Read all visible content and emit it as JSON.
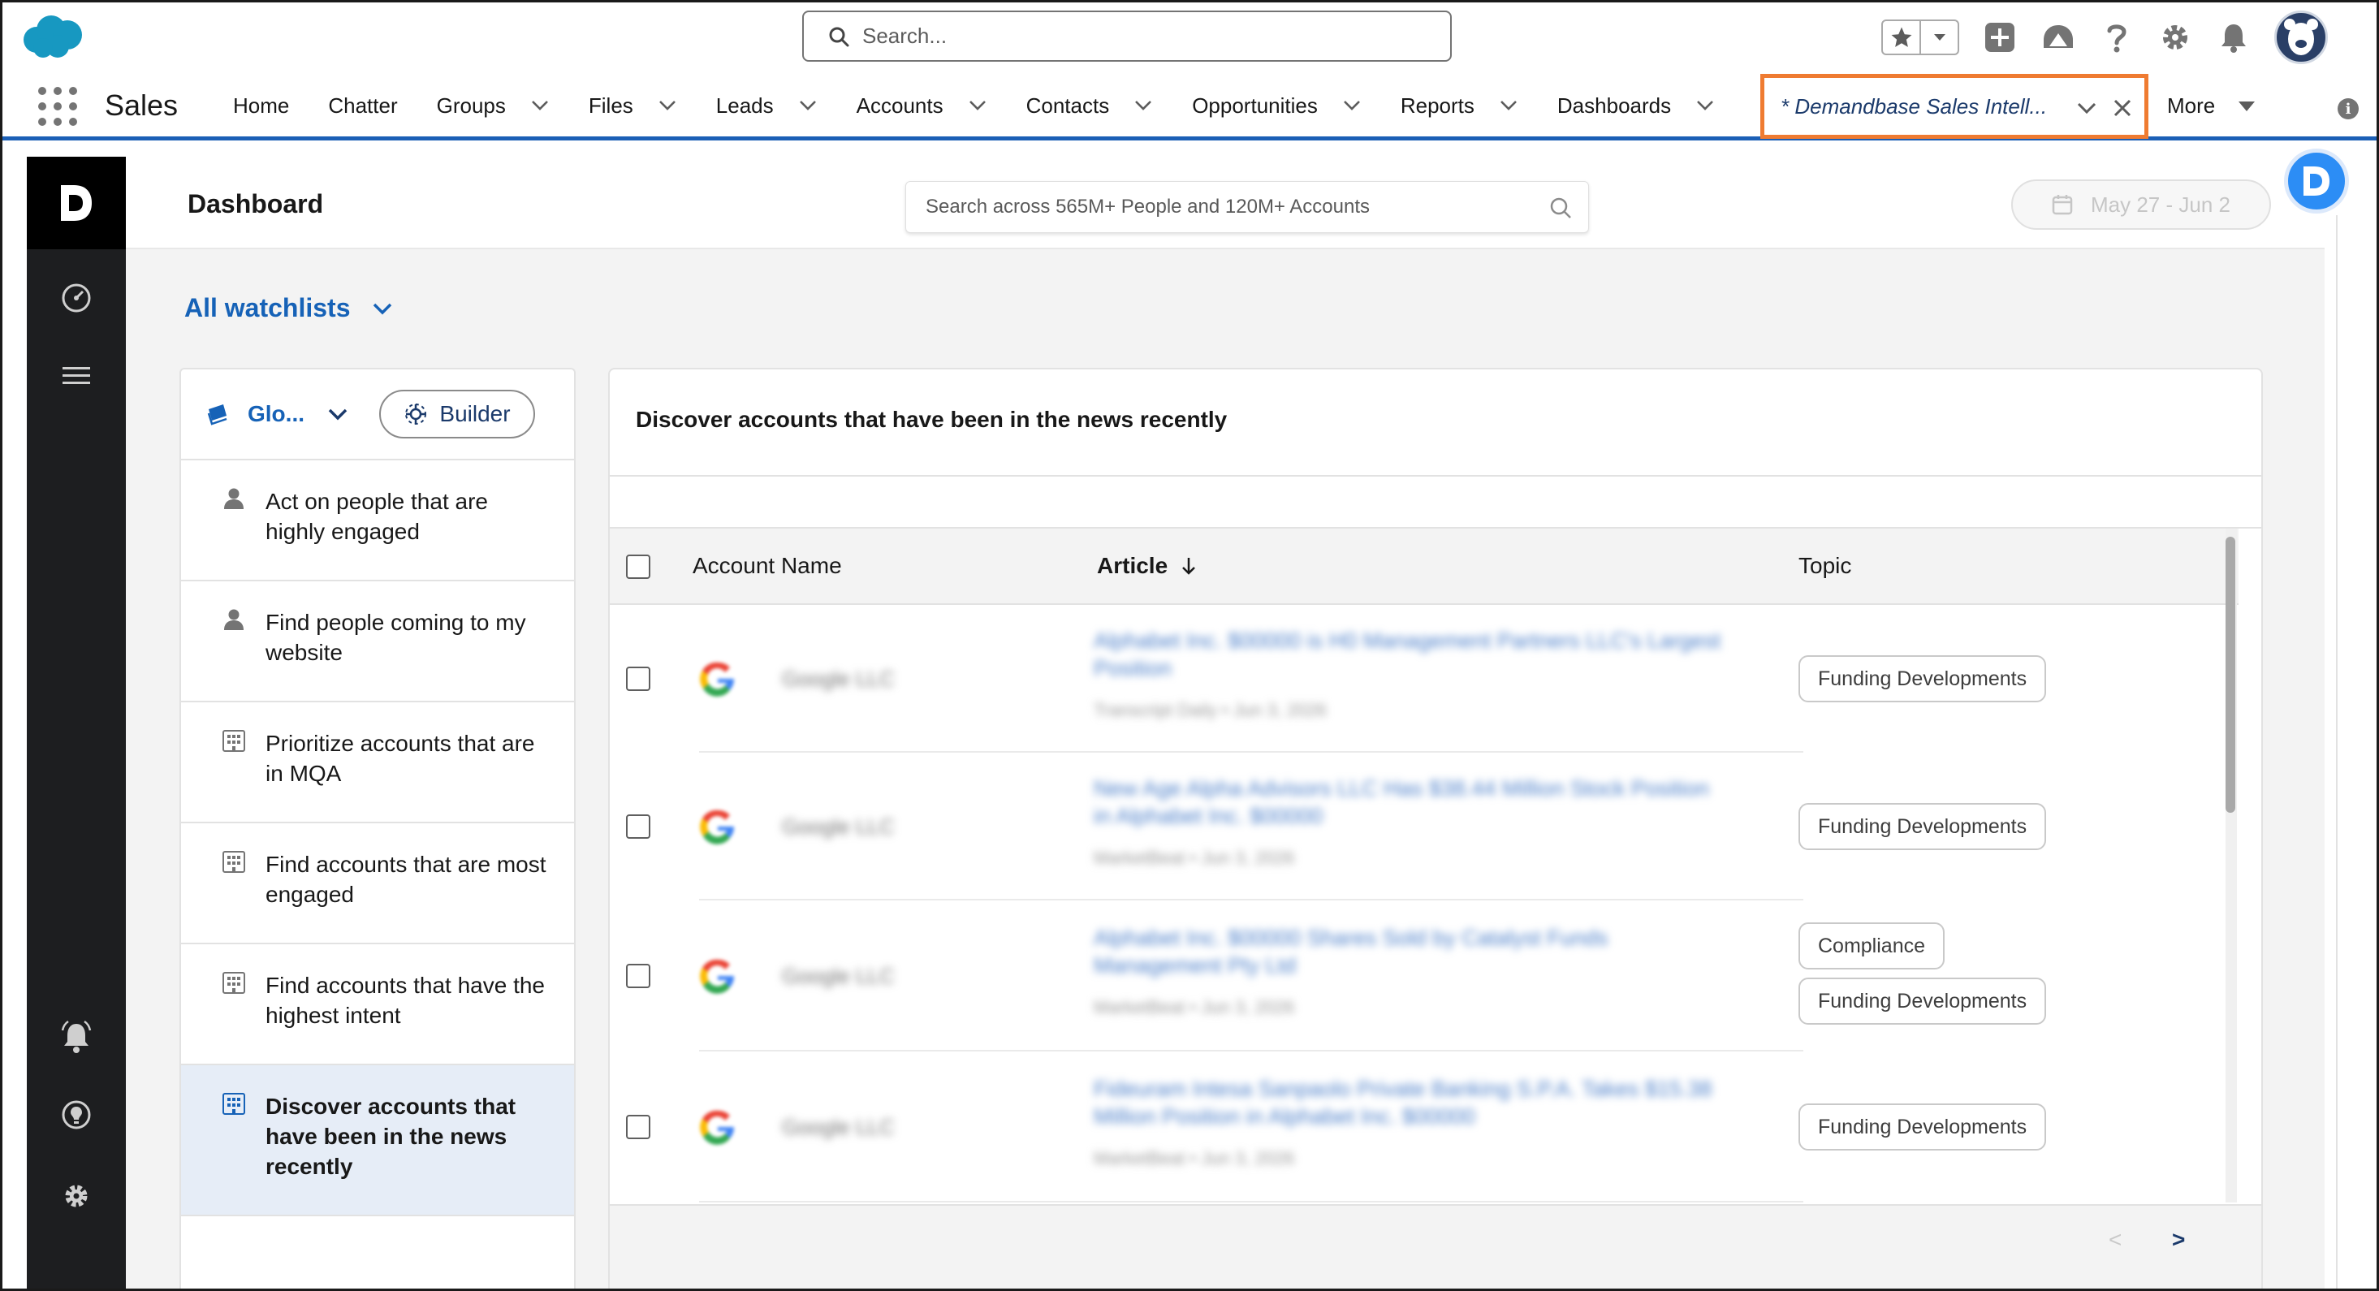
{
  "header": {
    "search_placeholder": "Search..."
  },
  "nav": {
    "app_name": "Sales",
    "items": [
      {
        "label": "Home",
        "has_menu": false
      },
      {
        "label": "Chatter",
        "has_menu": false
      },
      {
        "label": "Groups",
        "has_menu": true
      },
      {
        "label": "Files",
        "has_menu": true
      },
      {
        "label": "Leads",
        "has_menu": true
      },
      {
        "label": "Accounts",
        "has_menu": true
      },
      {
        "label": "Contacts",
        "has_menu": true
      },
      {
        "label": "Opportunities",
        "has_menu": true
      },
      {
        "label": "Reports",
        "has_menu": true
      },
      {
        "label": "Dashboards",
        "has_menu": true
      }
    ],
    "active_tab": "* Demandbase Sales Intell...",
    "more_label": "More"
  },
  "app": {
    "page_title": "Dashboard",
    "people_search_placeholder": "Search across 565M+ People and 120M+ Accounts",
    "date_range": "May 27 - Jun 2",
    "watchlists_label": "All watchlists",
    "badge_letter": "D",
    "logo_letter": "D"
  },
  "playbooks": {
    "selector_label": "Glo...",
    "builder_label": "Builder",
    "items": [
      {
        "label": "Act on people that are highly engaged",
        "icon": "person-icon",
        "active": false
      },
      {
        "label": "Find people coming to my website",
        "icon": "person-icon",
        "active": false
      },
      {
        "label": "Prioritize accounts that are in MQA",
        "icon": "building-icon",
        "active": false
      },
      {
        "label": "Find accounts that are most engaged",
        "icon": "building-icon",
        "active": false
      },
      {
        "label": "Find accounts that have the highest intent",
        "icon": "building-icon",
        "active": false
      },
      {
        "label": "Discover accounts that have been in the news recently",
        "icon": "building-icon",
        "active": true
      }
    ]
  },
  "card": {
    "title": "Discover accounts that have been in the news recently",
    "columns": {
      "account": "Account Name",
      "article": "Article",
      "topic": "Topic"
    },
    "rows": [
      {
        "account": "Google LLC",
        "article": "Alphabet Inc. $00000 is H0 Management Partners LLC's Largest Position",
        "meta": "Transcript Daily • Jun 3, 2026",
        "topics": [
          "Funding Developments"
        ]
      },
      {
        "account": "Google LLC",
        "article": "New Age Alpha Advisors LLC Has $38.44 Million Stock Position in Alphabet Inc. $00000",
        "meta": "MarketBeat • Jun 3, 2026",
        "topics": [
          "Funding Developments"
        ]
      },
      {
        "account": "Google LLC",
        "article": "Alphabet Inc. $00000 Shares Sold by Catalyst Funds Management Pty Ltd",
        "meta": "MarketBeat • Jun 3, 2026",
        "topics": [
          "Compliance",
          "Funding Developments"
        ]
      },
      {
        "account": "Google LLC",
        "article": "Fideuram Intesa Sanpaolo Private Banking S.P.A. Takes $15.38 Million Position in Alphabet Inc. $00000",
        "meta": "MarketBeat • Jun 3, 2026",
        "topics": [
          "Funding Developments"
        ]
      }
    ],
    "pager_prev": "<",
    "pager_next": ">"
  },
  "colors": {
    "brand_blue": "#1b5fb6",
    "link_blue": "#1662b7",
    "highlight_orange": "#ef7b31",
    "sidebar_dark": "#1d1e20"
  }
}
